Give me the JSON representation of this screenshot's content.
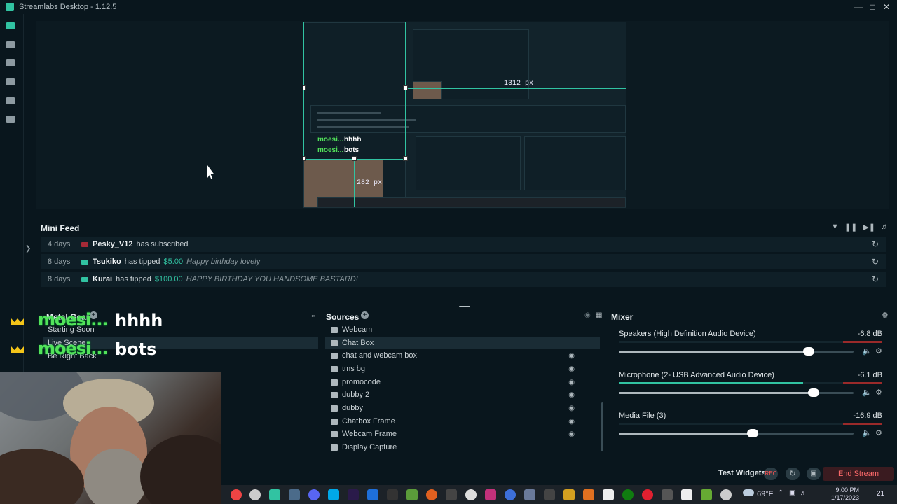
{
  "window": {
    "title": "Streamlabs Desktop - 1.12.5"
  },
  "preview": {
    "width_label": "1312 px",
    "height_label": "282 px",
    "inner_chat": [
      {
        "user": "moesi...",
        "message": "hhhh"
      },
      {
        "user": "moesi...",
        "message": "bots"
      }
    ]
  },
  "mini_feed": {
    "title": "Mini Feed",
    "events": [
      {
        "ago": "4 days",
        "user": "Pesky_V12",
        "action": "has subscribed",
        "amount": "",
        "message": "",
        "type": "sub"
      },
      {
        "ago": "8 days",
        "user": "Tsukiko",
        "action": "has tipped",
        "amount": "$5.00",
        "message": "Happy birthday lovely",
        "type": "tip"
      },
      {
        "ago": "8 days",
        "user": "Kurai",
        "action": "has tipped",
        "amount": "$100.00",
        "message": "HAPPY BIRTHDAY YOU HANDSOME BASTARD!",
        "type": "tip"
      }
    ]
  },
  "scenes": {
    "title": "Metal Gear",
    "items": [
      "Starting Soon",
      "Live Scene",
      "Be Right Back"
    ],
    "selected": "Live Scene"
  },
  "sources": {
    "title": "Sources",
    "items": [
      "Webcam",
      "Chat Box",
      "chat and webcam box",
      "tms bg",
      "promocode",
      "dubby 2",
      "dubby",
      "Chatbox Frame",
      "Webcam Frame",
      "Display Capture"
    ],
    "selected": "Chat Box"
  },
  "mixer": {
    "title": "Mixer",
    "channels": [
      {
        "name": "Speakers (High Definition Audio Device)",
        "db": "-6.8 dB",
        "volume": 0.81,
        "meter": 0.0
      },
      {
        "name": "Microphone (2- USB Advanced Audio Device)",
        "db": "-6.1 dB",
        "volume": 0.83,
        "meter": 0.7
      },
      {
        "name": "Media File (3)",
        "db": "-16.9 dB",
        "volume": 0.57,
        "meter": 0.0
      }
    ]
  },
  "overlay_chat": [
    {
      "user": "moesi...",
      "message": "hhhh"
    },
    {
      "user": "moesi...",
      "message": "bots"
    }
  ],
  "footer": {
    "test_widgets": "Test Widgets",
    "end_stream": "End Stream",
    "rec_label": "REC"
  },
  "taskbar": {
    "weather": "69°F",
    "time": "9:00 PM",
    "date": "1/17/2023",
    "notifications": "21"
  },
  "colors": {
    "accent": "#31c3a2",
    "background": "#09161d",
    "panel": "#0f1f27",
    "end_stream": "#ff6b6b"
  }
}
